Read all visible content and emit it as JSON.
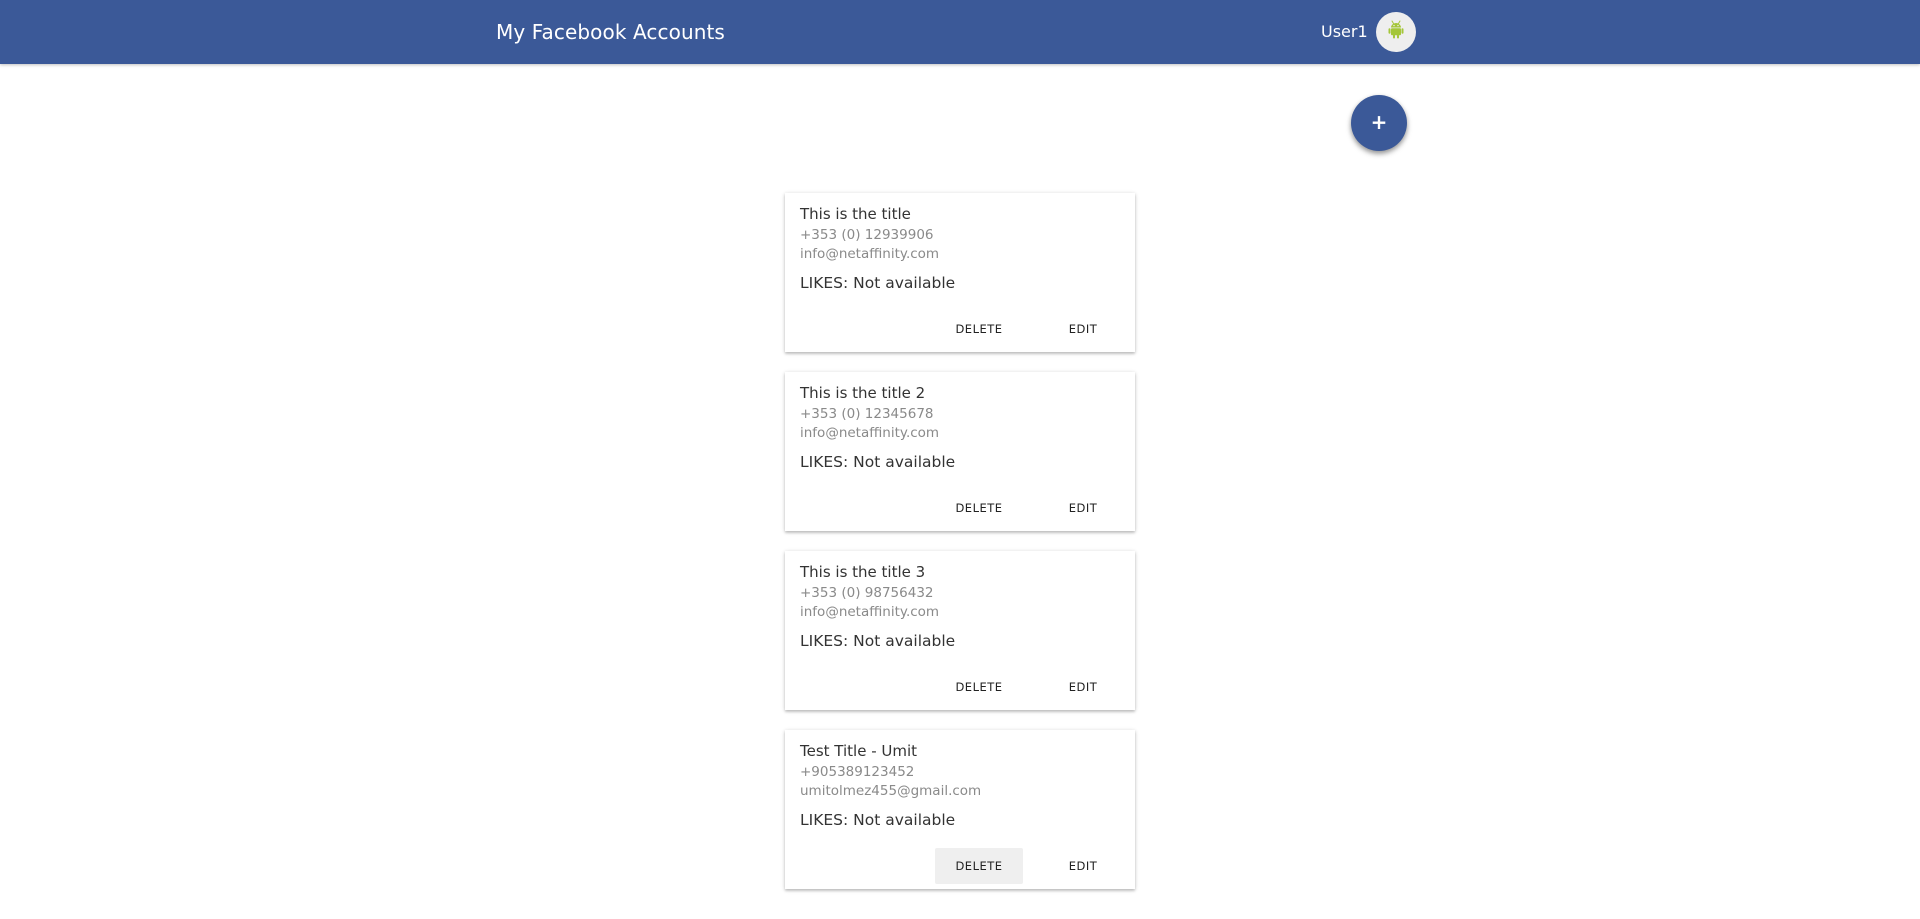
{
  "header": {
    "title": "My Facebook Accounts",
    "user_name": "User1",
    "avatar_icon": "android-icon",
    "background_color": "#3b5998"
  },
  "fab": {
    "icon": "plus-icon",
    "label": "+"
  },
  "accounts": [
    {
      "title": "This is the title",
      "phone": "+353 (0) 12939906",
      "email": "info@netaffinity.com",
      "likes": "LIKES: Not available",
      "delete_label": "DELETE",
      "edit_label": "EDIT"
    },
    {
      "title": "This is the title 2",
      "phone": "+353 (0) 12345678",
      "email": "info@netaffinity.com",
      "likes": "LIKES: Not available",
      "delete_label": "DELETE",
      "edit_label": "EDIT"
    },
    {
      "title": "This is the title 3",
      "phone": "+353 (0) 98756432",
      "email": "info@netaffinity.com",
      "likes": "LIKES: Not available",
      "delete_label": "DELETE",
      "edit_label": "EDIT"
    },
    {
      "title": "Test Title - Umit",
      "phone": "+905389123452",
      "email": "umitolmez455@gmail.com",
      "likes": "LIKES: Not available",
      "delete_label": "DELETE",
      "edit_label": "EDIT"
    }
  ]
}
